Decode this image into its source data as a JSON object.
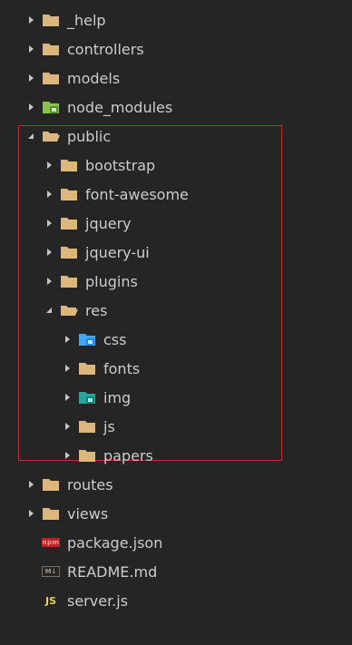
{
  "tree": [
    {
      "label": "_help",
      "depth": 0,
      "expanded": false,
      "icon": "folder-icon"
    },
    {
      "label": "controllers",
      "depth": 0,
      "expanded": false,
      "icon": "folder-icon"
    },
    {
      "label": "models",
      "depth": 0,
      "expanded": false,
      "icon": "folder-icon"
    },
    {
      "label": "node_modules",
      "depth": 0,
      "expanded": false,
      "icon": "folder-node-icon"
    },
    {
      "label": "public",
      "depth": 0,
      "expanded": true,
      "icon": "folder-open-icon"
    },
    {
      "label": "bootstrap",
      "depth": 1,
      "expanded": false,
      "icon": "folder-icon"
    },
    {
      "label": "font-awesome",
      "depth": 1,
      "expanded": false,
      "icon": "folder-icon"
    },
    {
      "label": "jquery",
      "depth": 1,
      "expanded": false,
      "icon": "folder-icon"
    },
    {
      "label": "jquery-ui",
      "depth": 1,
      "expanded": false,
      "icon": "folder-icon"
    },
    {
      "label": "plugins",
      "depth": 1,
      "expanded": false,
      "icon": "folder-icon"
    },
    {
      "label": "res",
      "depth": 1,
      "expanded": true,
      "icon": "folder-open-icon"
    },
    {
      "label": "css",
      "depth": 2,
      "expanded": false,
      "icon": "folder-css-icon"
    },
    {
      "label": "fonts",
      "depth": 2,
      "expanded": false,
      "icon": "folder-icon"
    },
    {
      "label": "img",
      "depth": 2,
      "expanded": false,
      "icon": "folder-images-icon"
    },
    {
      "label": "js",
      "depth": 2,
      "expanded": false,
      "icon": "folder-icon"
    },
    {
      "label": "papers",
      "depth": 2,
      "expanded": false,
      "icon": "folder-icon"
    },
    {
      "label": "routes",
      "depth": 0,
      "expanded": false,
      "icon": "folder-icon"
    },
    {
      "label": "views",
      "depth": 0,
      "expanded": false,
      "icon": "folder-icon"
    },
    {
      "label": "package.json",
      "depth": 0,
      "file": true,
      "icon": "npm-icon"
    },
    {
      "label": "README.md",
      "depth": 0,
      "file": true,
      "icon": "markdown-icon"
    },
    {
      "label": "server.js",
      "depth": 0,
      "file": true,
      "icon": "javascript-icon"
    }
  ],
  "icon_text": {
    "npm": "npm",
    "md": "M↓",
    "js": "JS"
  },
  "colors": {
    "background": "#252526",
    "text": "#cccccc",
    "folder": "#dcb67a",
    "node_folder": "#8bc34a",
    "css_folder": "#42a5f5",
    "img_folder": "#26a69a",
    "highlight_border": "#c42b2b",
    "npm_red": "#c12127",
    "js_yellow": "#e8d44d"
  }
}
